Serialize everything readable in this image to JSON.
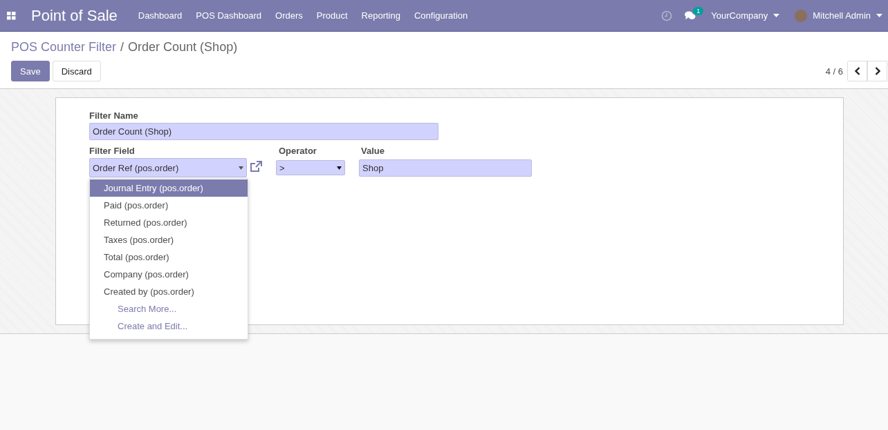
{
  "navbar": {
    "app_title": "Point of Sale",
    "menu": [
      "Dashboard",
      "POS Dashboard",
      "Orders",
      "Product",
      "Reporting",
      "Configuration"
    ],
    "messages_badge": "1",
    "company": "YourCompany",
    "user": "Mitchell Admin"
  },
  "breadcrumb": {
    "parent": "POS Counter Filter",
    "separator": "/",
    "current": "Order Count (Shop)"
  },
  "buttons": [
    "Save",
    "Discard"
  ],
  "pager": {
    "text": "4 / 6"
  },
  "form": {
    "filter_name": {
      "label": "Filter Name",
      "value": "Order Count (Shop)"
    },
    "filter_field": {
      "label": "Filter Field",
      "value": "Order Ref (pos.order)"
    },
    "operator": {
      "label": "Operator",
      "value": ">"
    },
    "value": {
      "label": "Value",
      "value": "Shop"
    }
  },
  "dropdown": [
    {
      "label": "Journal Entry (pos.order)",
      "kind": "option",
      "selected": true
    },
    {
      "label": "Paid (pos.order)",
      "kind": "option",
      "selected": false
    },
    {
      "label": "Returned (pos.order)",
      "kind": "option",
      "selected": false
    },
    {
      "label": "Taxes (pos.order)",
      "kind": "option",
      "selected": false
    },
    {
      "label": "Total (pos.order)",
      "kind": "option",
      "selected": false
    },
    {
      "label": "Company (pos.order)",
      "kind": "option",
      "selected": false
    },
    {
      "label": "Created by (pos.order)",
      "kind": "option",
      "selected": false
    },
    {
      "label": "Search More...",
      "kind": "action",
      "selected": false
    },
    {
      "label": "Create and Edit...",
      "kind": "action",
      "selected": false
    }
  ]
}
